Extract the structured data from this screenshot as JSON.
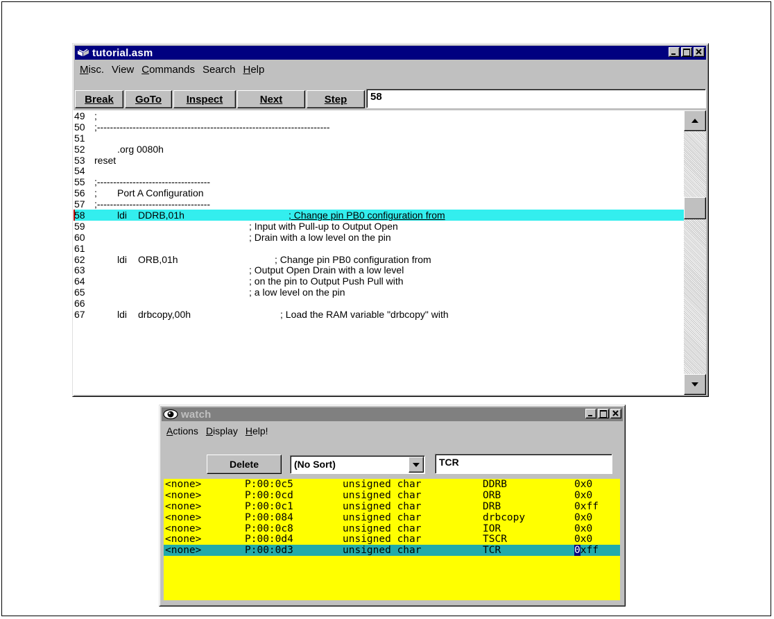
{
  "editor": {
    "title": "tutorial.asm",
    "menu": [
      {
        "label": "Misc.",
        "u": "M",
        "rest": "isc."
      },
      {
        "label": "View",
        "u": "",
        "rest": "View"
      },
      {
        "label": "Commands",
        "u": "C",
        "rest": "ommands"
      },
      {
        "label": "Search",
        "u": "",
        "rest": "Search"
      },
      {
        "label": "Help",
        "u": "H",
        "rest": "elp"
      }
    ],
    "buttons": {
      "break": "Break",
      "goto": "GoTo",
      "inspect": "Inspect",
      "next": "Next",
      "step": "Step"
    },
    "line_field": "58",
    "lines": [
      {
        "num": "49",
        "c1": ";",
        "c2": "",
        "c3": "",
        "cm": ""
      },
      {
        "num": "50",
        "c1": ";------------------------------------------------------------------------",
        "c2": "",
        "c3": "",
        "cm": ""
      },
      {
        "num": "51",
        "c1": "",
        "c2": "",
        "c3": "",
        "cm": ""
      },
      {
        "num": "52",
        "c1": "",
        "c2": ".org 0080h",
        "c3": "",
        "cm": ""
      },
      {
        "num": "53",
        "c1": "reset",
        "c2": "",
        "c3": "",
        "cm": ""
      },
      {
        "num": "54",
        "c1": "",
        "c2": "",
        "c3": "",
        "cm": ""
      },
      {
        "num": "55",
        "c1": ";-----------------------------------",
        "c2": "",
        "c3": "",
        "cm": ""
      },
      {
        "num": "56",
        "c1": ";",
        "c2": "Port A Configuration",
        "c3": "",
        "cm": ""
      },
      {
        "num": "57",
        "c1": ";-----------------------------------",
        "c2": "",
        "c3": "",
        "cm": ""
      },
      {
        "num": "58",
        "c1": "",
        "c2": "ldi",
        "c3": "DDRB,01h",
        "cm": "; Change pin PB0 configuration from",
        "hl": true
      },
      {
        "num": "59",
        "c1": "",
        "c2": "",
        "c3": "",
        "cm": "; Input with Pull-up to Output Open"
      },
      {
        "num": "60",
        "c1": "",
        "c2": "",
        "c3": "",
        "cm": "; Drain with a low level on the pin"
      },
      {
        "num": "61",
        "c1": "",
        "c2": "",
        "c3": "",
        "cm": ""
      },
      {
        "num": "62",
        "c1": "",
        "c2": "ldi",
        "c3": "ORB,01h",
        "cm": "; Change pin PB0 configuration from"
      },
      {
        "num": "63",
        "c1": "",
        "c2": "",
        "c3": "",
        "cm": "; Output Open Drain with a low level"
      },
      {
        "num": "64",
        "c1": "",
        "c2": "",
        "c3": "",
        "cm": "; on the pin to Output Push Pull with"
      },
      {
        "num": "65",
        "c1": "",
        "c2": "",
        "c3": "",
        "cm": "; a low level on the pin"
      },
      {
        "num": "66",
        "c1": "",
        "c2": "",
        "c3": "",
        "cm": ""
      },
      {
        "num": "67",
        "c1": "",
        "c2": "ldi",
        "c3": "drbcopy,00h",
        "cm": "; Load the RAM variable \"drbcopy\" with"
      }
    ],
    "scroll_position": 0.3
  },
  "watch": {
    "title": "watch",
    "menu": [
      {
        "label": "Actions",
        "u": "A",
        "rest": "ctions"
      },
      {
        "label": "Display",
        "u": "D",
        "rest": "isplay"
      },
      {
        "label": "Help!",
        "u": "H",
        "rest": "elp!"
      }
    ],
    "delete_label": "Delete",
    "sort_value": "(No Sort)",
    "symbol_field": "TCR",
    "rows": [
      {
        "c0": "<none>",
        "c1": "P:00:0c5",
        "c2": "unsigned char",
        "c3": "DDRB",
        "c4": "0x0"
      },
      {
        "c0": "<none>",
        "c1": "P:00:0cd",
        "c2": "unsigned char",
        "c3": "ORB",
        "c4": "0x0"
      },
      {
        "c0": "<none>",
        "c1": "P:00:0c1",
        "c2": "unsigned char",
        "c3": "DRB",
        "c4": "0xff"
      },
      {
        "c0": "<none>",
        "c1": "P:00:084",
        "c2": "unsigned char",
        "c3": "drbcopy",
        "c4": "0x0"
      },
      {
        "c0": "<none>",
        "c1": "P:00:0c8",
        "c2": "unsigned char",
        "c3": "IOR",
        "c4": "0x0"
      },
      {
        "c0": "<none>",
        "c1": "P:00:0d4",
        "c2": "unsigned char",
        "c3": "TSCR",
        "c4": "0x0"
      },
      {
        "c0": "<none>",
        "c1": "P:00:0d3",
        "c2": "unsigned char",
        "c3": "TCR",
        "c4": "0xff",
        "sel": true
      }
    ]
  },
  "colors": {
    "active_title": "#000080",
    "inactive_title": "#808080",
    "highlight_line": "#33eeee",
    "watch_bg": "#ffff00",
    "watch_selected": "#22aaaa"
  },
  "icons": {
    "editor_icon": "book-icon",
    "watch_icon": "eye-icon"
  }
}
